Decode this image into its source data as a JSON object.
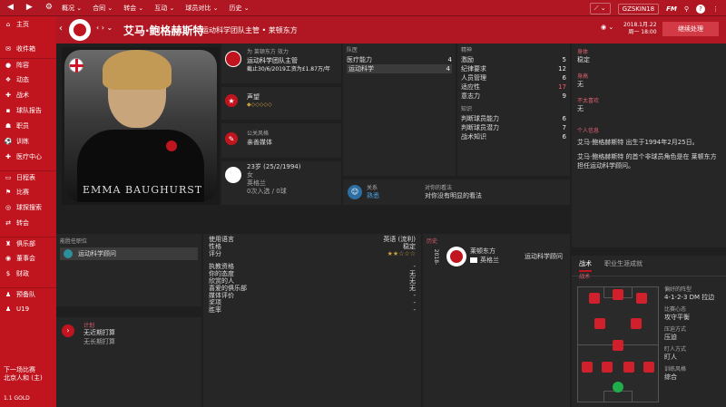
{
  "topbar": {
    "menu": [
      "概况 ⌄",
      "合同 ⌄",
      "转会 ⌄",
      "互动 ⌄",
      "球员对比 ⌄",
      "历史 ⌄"
    ],
    "save": "GZSKIN18",
    "fm": "FM",
    "search": "Q"
  },
  "sidebar": {
    "team": "主页",
    "items": [
      {
        "icon": "⌂",
        "label": "主页"
      },
      {
        "icon": "✉",
        "label": "收件箱"
      },
      {
        "icon": "●",
        "label": "阵容"
      },
      {
        "icon": "❖",
        "label": "动态"
      },
      {
        "icon": "✚",
        "label": "战术"
      },
      {
        "icon": "▪",
        "label": "球队报告"
      },
      {
        "icon": "☗",
        "label": "职员"
      },
      {
        "icon": "⚽",
        "label": "训练"
      },
      {
        "icon": "✚",
        "label": "医疗中心"
      },
      {
        "icon": "▭",
        "label": "日程表"
      },
      {
        "icon": "⚑",
        "label": "比赛"
      },
      {
        "icon": "◎",
        "label": "球探搜索"
      },
      {
        "icon": "⇄",
        "label": "转会"
      },
      {
        "icon": "♜",
        "label": "俱乐部"
      },
      {
        "icon": "◉",
        "label": "董事会"
      },
      {
        "icon": "$",
        "label": "财政"
      },
      {
        "icon": "♟",
        "label": "预备队"
      },
      {
        "icon": "♟",
        "label": "U19"
      }
    ],
    "next_match_label": "下一场比赛",
    "next_match": "北京人和 (主)",
    "balance": "1.1 GOLD"
  },
  "header": {
    "name": "艾马·鲍格赫斯特",
    "role": "运动科学团队主管 • 莱顿东方",
    "date_line1": "2018.1月.22",
    "date_line2": "周一 18:00",
    "continue": "继续处理"
  },
  "photo": {
    "caption": "EMMA BAUGHURST"
  },
  "job": {
    "for_club": "为 莱顿东方 效力",
    "title": "运动科学团队主管",
    "contract": "截止30/6/2019工资为£1.87万/年"
  },
  "reputation": {
    "label": "声望"
  },
  "media": {
    "label": "公关风格",
    "value": "亲善媒体"
  },
  "personal": {
    "age": "23岁 (25/2/1994)",
    "gender": "女",
    "nation": "英格兰",
    "caps": "0次入选 / 0球"
  },
  "skills": {
    "group1_label": "队医",
    "group1": [
      {
        "name": "医疗能力",
        "v": "4"
      },
      {
        "name": "运动科学",
        "v": "4"
      }
    ],
    "group2_label": "精神",
    "group2": [
      {
        "name": "激励",
        "v": "5"
      },
      {
        "name": "纪律要求",
        "v": "12"
      },
      {
        "name": "人员管理",
        "v": "6"
      },
      {
        "name": "适应性",
        "v": "17"
      },
      {
        "name": "意志力",
        "v": "9"
      }
    ],
    "group3_label": "知识",
    "group3": [
      {
        "name": "判断球员能力",
        "v": "6"
      },
      {
        "name": "判断球员潜力",
        "v": "7"
      },
      {
        "name": "战术知识",
        "v": "6"
      }
    ]
  },
  "relation": {
    "label": "关系",
    "value": "熟悉",
    "view_label": "对你的看法",
    "view": "对你没有明显的看法"
  },
  "right": {
    "status_label": "身体",
    "status": "稳定",
    "injury_label": "身高",
    "injury": "无",
    "other_label": "不太喜欢",
    "other": "无",
    "profile_label": "个人信息",
    "profile1": "艾马·鲍格赫斯特 出生于1994年2月25日。",
    "profile2": "艾马·鲍格赫斯特 的首个非球员角色是在 莱顿东方 担任运动科学顾问。",
    "tabs": [
      "战术",
      "职业生涯成就"
    ],
    "tactics_label": "战术",
    "pref_formation_label": "偏好的阵型",
    "pref_formation": "4-1-2-3 DM 拉边",
    "mentality_label": "比赛心态",
    "mentality": "攻守平衡",
    "pressing_label": "压迫方式",
    "pressing": "压迫",
    "marking_label": "盯人方式",
    "marking": "盯人",
    "training_label": "训练风格",
    "training": "综合"
  },
  "roles": {
    "label": "能胜任职位",
    "item": "运动科学顾问"
  },
  "plans": {
    "label": "计划",
    "line1": "无近期打算",
    "line2": "无长期打算"
  },
  "details": [
    {
      "k": "使用语言",
      "v": "英语 (流利)"
    },
    {
      "k": "性格",
      "v": "稳定"
    },
    {
      "k": "评分",
      "v": "★★☆☆☆"
    },
    {
      "k": "执教资格",
      "v": "-"
    },
    {
      "k": "你的态度",
      "v": "无"
    },
    {
      "k": "欣赏的人",
      "v": "无"
    },
    {
      "k": "喜爱的俱乐部",
      "v": "无"
    },
    {
      "k": "媒体评价",
      "v": "-"
    },
    {
      "k": "奖项",
      "v": "-"
    },
    {
      "k": "胜率",
      "v": "-"
    }
  ],
  "history": {
    "label": "历史",
    "years": "2018-",
    "club": "莱顿东方",
    "nation": "英格兰",
    "role": "运动科学顾问"
  },
  "colors": {
    "accent": "#c0141f"
  }
}
